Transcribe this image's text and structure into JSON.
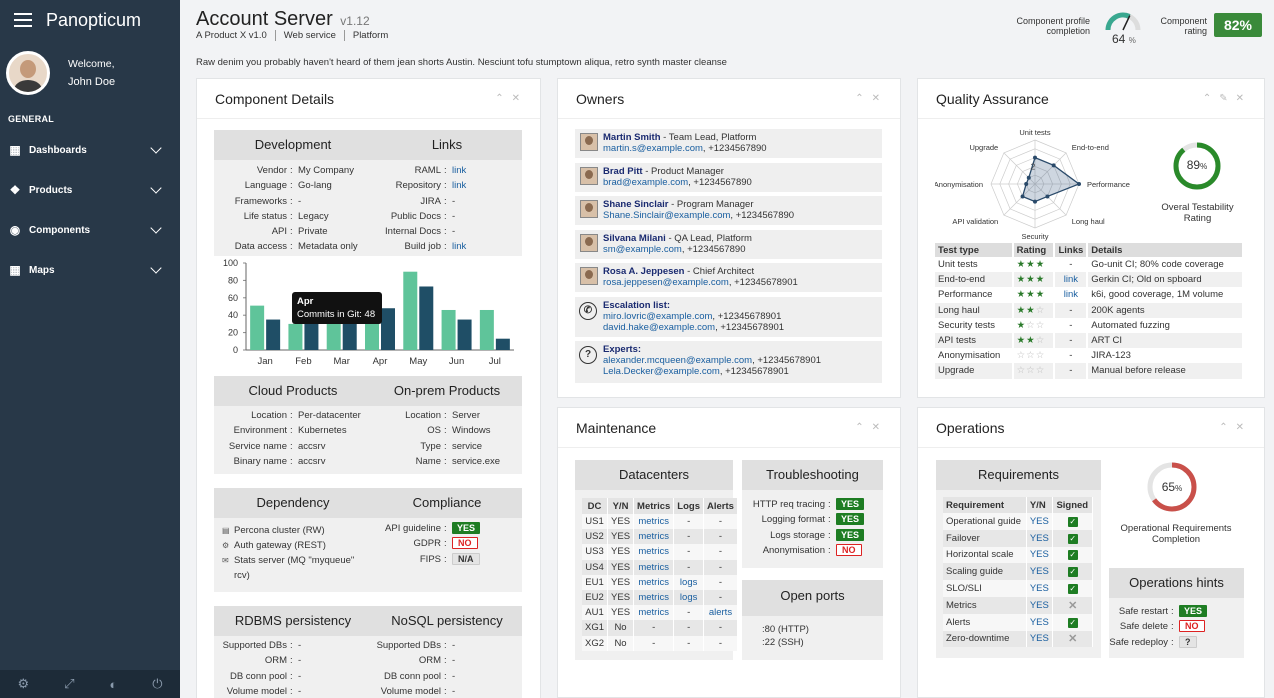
{
  "app": {
    "name": "Panopticum"
  },
  "user": {
    "welcome": "Welcome,",
    "name": "John Doe"
  },
  "nav": {
    "section": "GENERAL",
    "items": [
      {
        "label": "Dashboards",
        "icon": "table-icon"
      },
      {
        "label": "Products",
        "icon": "cubes-icon"
      },
      {
        "label": "Components",
        "icon": "dot-circle-icon"
      },
      {
        "label": "Maps",
        "icon": "grid-icon"
      }
    ]
  },
  "header": {
    "title": "Account Server",
    "version": "v1.12",
    "breadcrumb": [
      "A Product X v1.0",
      "Web service",
      "Platform"
    ],
    "description": "Raw denim you probably haven't heard of them jean shorts Austin. Nesciunt tofu stumptown aliqua, retro synth master cleanse"
  },
  "profile": {
    "label_line1": "Component profile",
    "label_line2": "completion",
    "value": 64,
    "unit": "%"
  },
  "rating": {
    "label_line1": "Component",
    "label_line2": "rating",
    "value": "82%"
  },
  "component_details": {
    "title": "Component Details",
    "development": {
      "title": "Development",
      "rows": [
        [
          "Vendor",
          "My Company"
        ],
        [
          "Language",
          "Go-lang"
        ],
        [
          "Frameworks",
          "-"
        ],
        [
          "Life status",
          "Legacy"
        ],
        [
          "API",
          "Private"
        ],
        [
          "Data access",
          "Metadata only"
        ]
      ]
    },
    "links": {
      "title": "Links",
      "rows": [
        [
          "RAML",
          "link",
          true
        ],
        [
          "Repository",
          "link",
          true
        ],
        [
          "JIRA",
          "-",
          false
        ],
        [
          "Public Docs",
          "-",
          false
        ],
        [
          "Internal Docs",
          "-",
          false
        ],
        [
          "Build job",
          "link",
          true
        ]
      ]
    },
    "cloud": {
      "title": "Cloud Products",
      "rows": [
        [
          "Location",
          "Per-datacenter"
        ],
        [
          "Environment",
          "Kubernetes"
        ],
        [
          "Service name",
          "accsrv"
        ],
        [
          "Binary name",
          "accsrv"
        ]
      ]
    },
    "onprem": {
      "title": "On-prem Products",
      "rows": [
        [
          "Location",
          "Server"
        ],
        [
          "OS",
          "Windows"
        ],
        [
          "Type",
          "service"
        ],
        [
          "Name",
          "service.exe"
        ]
      ]
    },
    "dependency": {
      "title": "Dependency",
      "items": [
        {
          "label": "Percona cluster (RW)",
          "icon": "database-icon"
        },
        {
          "label": "Auth gateway (REST)",
          "icon": "gear-icon"
        },
        {
          "label": "Stats server (MQ \"myqueue\" rcv)",
          "icon": "envelope-icon"
        }
      ]
    },
    "compliance": {
      "title": "Compliance",
      "rows": [
        [
          "API guideline",
          "YES",
          "yes"
        ],
        [
          "GDPR",
          "NO",
          "no"
        ],
        [
          "FIPS",
          "N/A",
          "na"
        ]
      ]
    },
    "rdbms": {
      "title": "RDBMS persistency",
      "rows": [
        [
          "Supported DBs",
          "-"
        ],
        [
          "ORM",
          "-"
        ],
        [
          "DB conn pool",
          "-"
        ],
        [
          "Volume model",
          "-"
        ]
      ]
    },
    "nosql": {
      "title": "NoSQL persistency",
      "rows": [
        [
          "Supported DBs",
          "-"
        ],
        [
          "ORM",
          "-"
        ],
        [
          "DB conn pool",
          "-"
        ],
        [
          "Volume model",
          "-"
        ]
      ]
    },
    "tooltip": {
      "title": "Apr",
      "text": "Commits in Git: 48"
    }
  },
  "chart_data": {
    "type": "bar",
    "categories": [
      "Jan",
      "Feb",
      "Mar",
      "Apr",
      "May",
      "Jun",
      "Jul"
    ],
    "series": [
      {
        "values": [
          51,
          30,
          30,
          30,
          90,
          46,
          46
        ],
        "color": "#5fc49a"
      },
      {
        "values": [
          35,
          62,
          42,
          48,
          73,
          35,
          13
        ],
        "color": "#1f4e66"
      }
    ],
    "ylim": [
      0,
      100
    ],
    "yticks": [
      0,
      20,
      40,
      60,
      80,
      100
    ],
    "highlight": "Apr"
  },
  "owners": {
    "title": "Owners",
    "people": [
      {
        "name": "Martin Smith",
        "role": " - Team Lead, Platform",
        "email": "martin.s@example.com",
        "phone": ", +1234567890"
      },
      {
        "name": "Brad Pitt",
        "role": " - Product Manager",
        "email": "brad@example.com",
        "phone": ", +1234567890"
      },
      {
        "name": "Shane Sinclair",
        "role": " - Program Manager",
        "email": "Shane.Sinclair@example.com",
        "phone": ", +1234567890"
      },
      {
        "name": "Silvana Milani",
        "role": " - QA Lead, Platform",
        "email": "sm@example.com",
        "phone": ", +1234567890"
      },
      {
        "name": "Rosa A. Jeppesen",
        "role": " - Chief Architect",
        "email": "rosa.jeppesen@example.com",
        "phone": ", +12345678901"
      }
    ],
    "escalation": {
      "label": "Escalation list:",
      "rows": [
        {
          "email": "miro.lovric@example.com",
          "phone": ", +12345678901"
        },
        {
          "email": "david.hake@example.com",
          "phone": ", +12345678901"
        }
      ]
    },
    "experts": {
      "label": "Experts:",
      "rows": [
        {
          "email": "alexander.mcqueen@example.com",
          "phone": ", +12345678901"
        },
        {
          "email": "Lela.Decker@example.com",
          "phone": ", +12345678901"
        }
      ]
    }
  },
  "qa": {
    "title": "Quality Assurance",
    "radar_labels": [
      "Unit tests",
      "End-to-end",
      "Performance",
      "Long haul",
      "Security",
      "API validation",
      "Anonymisation",
      "Upgrade"
    ],
    "radar_values": [
      3,
      3,
      5,
      2,
      2,
      2,
      1,
      1
    ],
    "radar_tick": "2",
    "testability": {
      "value": 89,
      "unit": "%",
      "label_line1": "Overal Testability",
      "label_line2": "Rating"
    },
    "headers": [
      "Test type",
      "Rating",
      "Links",
      "Details"
    ],
    "rows": [
      [
        "Unit tests",
        3,
        "-",
        "Go-unit CI; 80% code coverage"
      ],
      [
        "End-to-end",
        3,
        "link",
        "Gerkin CI; Old on spboard"
      ],
      [
        "Performance",
        3,
        "link",
        "k6i, good coverage, 1M volume"
      ],
      [
        "Long haul",
        2,
        "-",
        "200K agents"
      ],
      [
        "Security tests",
        1,
        "-",
        "Automated fuzzing"
      ],
      [
        "API tests",
        2,
        "-",
        "ART CI"
      ],
      [
        "Anonymisation",
        0,
        "-",
        "JIRA-123"
      ],
      [
        "Upgrade",
        0,
        "-",
        "Manual before release"
      ]
    ]
  },
  "maintenance": {
    "title": "Maintenance",
    "datacenters": {
      "title": "Datacenters",
      "headers": [
        "DC",
        "Y/N",
        "Metrics",
        "Logs",
        "Alerts"
      ],
      "rows": [
        [
          "US1",
          "YES",
          "metrics",
          "-",
          "-"
        ],
        [
          "US2",
          "YES",
          "metrics",
          "-",
          "-"
        ],
        [
          "US3",
          "YES",
          "metrics",
          "-",
          "-"
        ],
        [
          "US4",
          "YES",
          "metrics",
          "-",
          "-"
        ],
        [
          "EU1",
          "YES",
          "metrics",
          "logs",
          "-"
        ],
        [
          "EU2",
          "YES",
          "metrics",
          "logs",
          "-"
        ],
        [
          "AU1",
          "YES",
          "metrics",
          "-",
          "alerts"
        ],
        [
          "XG1",
          "No",
          "-",
          "-",
          "-"
        ],
        [
          "XG2",
          "No",
          "-",
          "-",
          "-"
        ]
      ]
    },
    "troubleshooting": {
      "title": "Troubleshooting",
      "rows": [
        [
          "HTTP req tracing",
          "YES",
          "yes"
        ],
        [
          "Logging format",
          "YES",
          "yes"
        ],
        [
          "Logs storage",
          "YES",
          "yes"
        ],
        [
          "Anonymisation",
          "NO",
          "no"
        ]
      ]
    },
    "ports": {
      "title": "Open ports",
      "items": [
        ":80 (HTTP)",
        ":22 (SSH)"
      ]
    }
  },
  "operations": {
    "title": "Operations",
    "requirements": {
      "title": "Requirements",
      "headers": [
        "Requirement",
        "Y/N",
        "Signed"
      ],
      "rows": [
        [
          "Operational guide",
          "YES",
          true
        ],
        [
          "Failover",
          "YES",
          true
        ],
        [
          "Horizontal scale",
          "YES",
          true
        ],
        [
          "Scaling guide",
          "YES",
          true
        ],
        [
          "SLO/SLI",
          "YES",
          true
        ],
        [
          "Metrics",
          "YES",
          false
        ],
        [
          "Alerts",
          "YES",
          true
        ],
        [
          "Zero-downtime",
          "YES",
          false
        ]
      ]
    },
    "completion": {
      "value": 65,
      "unit": "%",
      "label_line1": "Operational Requirements",
      "label_line2": "Completion"
    },
    "hints": {
      "title": "Operations hints",
      "rows": [
        [
          "Safe restart",
          "YES",
          "yes"
        ],
        [
          "Safe delete",
          "NO",
          "no"
        ],
        [
          "Safe redeploy",
          "?",
          "na"
        ]
      ]
    }
  },
  "colors": {
    "sidebar": "#283848",
    "accent_green": "#1e7d23",
    "bar_light": "#5fc49a",
    "bar_dark": "#1f4e66",
    "gauge_teal": "#3aa890",
    "ops_red": "#c9504a"
  }
}
